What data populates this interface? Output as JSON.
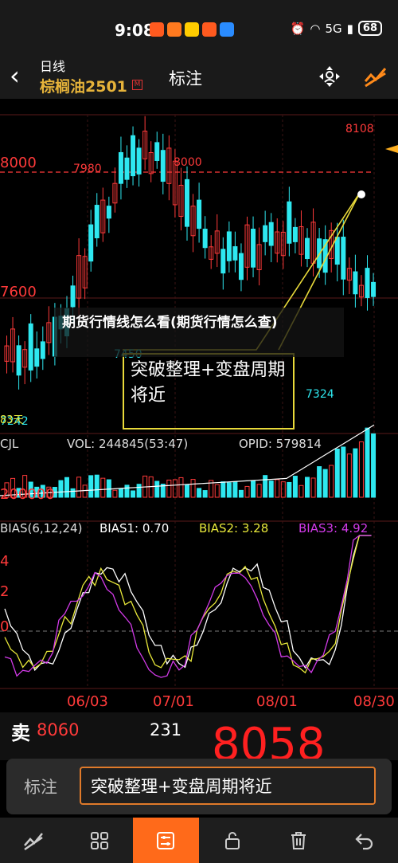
{
  "status": {
    "time": "9:08",
    "battery": "68",
    "signal": "5G",
    "app_colors": [
      "#ff5a1f",
      "#ff7a1f",
      "#ffcc00",
      "#ff5a1f",
      "#2a8cff"
    ]
  },
  "nav": {
    "period": "日线",
    "contract": "棕榈油2501",
    "badge": "M",
    "title": "标注"
  },
  "chart": {
    "price_labels": {
      "p8000": "8000",
      "p7600": "7600"
    },
    "peak_labels": {
      "l7980": "7980",
      "l8000": "8000",
      "l8108": "8108",
      "l7450": "7450",
      "l7324": "7324",
      "l7242": "7242",
      "l83": "83天"
    },
    "annotation": "突破整理+变盘周期将近",
    "vol_header": {
      "cjl": "CJL",
      "vol": "VOL: 244845(53:47)",
      "opid": "OPID: 579814"
    },
    "vol_axis": "200000",
    "bias_header": {
      "name": "BIAS(6,12,24)",
      "b1": "BIAS1: 0.70",
      "b2": "BIAS2: 3.28",
      "b3": "BIAS3: 4.92"
    },
    "bias_axis": {
      "a4": "4",
      "a2": "2",
      "a0": "0"
    },
    "dates": {
      "d1": "06/03",
      "d2": "07/01",
      "d3": "08/01",
      "d4": "08/30"
    },
    "colors": {
      "up": "#ff3a3a",
      "down": "#2ee8f0",
      "bias1": "#ffffff",
      "bias2": "#e8e83a",
      "bias3": "#d23ae8"
    }
  },
  "overlay_title": "期货行情线怎么看(期货行情怎么查)",
  "quote": {
    "side": "卖",
    "sell_price": "8060",
    "sell_vol": "231",
    "last_price": "8058"
  },
  "input": {
    "tag": "标注",
    "value": "突破整理+变盘周期将近"
  },
  "toolbar": [
    "draw-icon",
    "grid-icon",
    "settings-icon",
    "lock-icon",
    "delete-icon",
    "undo-icon"
  ]
}
